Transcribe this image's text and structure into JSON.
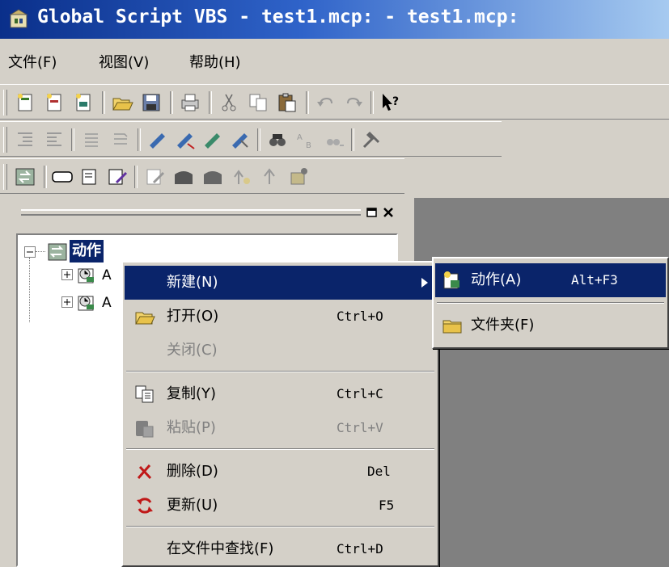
{
  "window": {
    "title": "Global Script VBS - test1.mcp: - test1.mcp:",
    "app_icon": "vbs-app-icon"
  },
  "menubar": {
    "items": [
      {
        "label": "文件(F)"
      },
      {
        "label": "视图(V)"
      },
      {
        "label": "帮助(H)"
      }
    ]
  },
  "toolbars": {
    "row1": [
      "new-project-icon",
      "new-action-icon",
      "new-function-icon",
      "open-icon",
      "save-icon",
      "print-icon",
      "cut-icon",
      "copy-icon",
      "paste-icon",
      "undo-icon",
      "redo-icon",
      "context-help-icon"
    ],
    "row2": [
      "indent-icon",
      "outdent-icon",
      "comment-icon",
      "uncomment-icon",
      "bookmark-toggle-icon",
      "bookmark-next-icon",
      "bookmark-prev-icon",
      "bookmark-clear-icon",
      "find-icon",
      "replace-icon",
      "find-next-icon",
      "compile-icon"
    ],
    "row3": [
      "trigger-icon",
      "button-icon",
      "tag-icon",
      "tag-edit-icon",
      "edit-icon",
      "block-icon",
      "block2-icon",
      "arrow-up-icon",
      "arrow-up2-icon",
      "info-icon"
    ]
  },
  "tree": {
    "root_label": "动作",
    "children": [
      {
        "label": "A"
      },
      {
        "label": "A"
      }
    ]
  },
  "context_menu": {
    "items": [
      {
        "label": "新建(N)",
        "shortcut": "",
        "icon": "",
        "state": "highlighted",
        "submenu": true
      },
      {
        "label": "打开(O)",
        "shortcut": "Ctrl+O",
        "icon": "open-folder-icon",
        "state": "enabled"
      },
      {
        "label": "关闭(C)",
        "shortcut": "",
        "icon": "",
        "state": "disabled"
      },
      {
        "label": "复制(Y)",
        "shortcut": "Ctrl+C",
        "icon": "copy-icon",
        "state": "enabled"
      },
      {
        "label": "粘贴(P)",
        "shortcut": "Ctrl+V",
        "icon": "paste-icon",
        "state": "disabled"
      },
      {
        "label": "删除(D)",
        "shortcut": "Del",
        "icon": "delete-icon",
        "state": "enabled"
      },
      {
        "label": "更新(U)",
        "shortcut": "F5",
        "icon": "refresh-icon",
        "state": "enabled"
      },
      {
        "label": "在文件中查找(F)",
        "shortcut": "Ctrl+D",
        "icon": "",
        "state": "enabled"
      }
    ]
  },
  "submenu": {
    "items": [
      {
        "label": "动作(A)",
        "shortcut": "Alt+F3",
        "icon": "action-icon",
        "state": "highlighted"
      },
      {
        "label": "文件夹(F)",
        "shortcut": "",
        "icon": "folder-icon",
        "state": "enabled"
      }
    ]
  },
  "colors": {
    "title_gradient_start": "#0a2f8a",
    "title_gradient_end": "#a6caf0",
    "highlight": "#0a246a",
    "panel_gray": "#808080",
    "face": "#d4d0c8"
  }
}
